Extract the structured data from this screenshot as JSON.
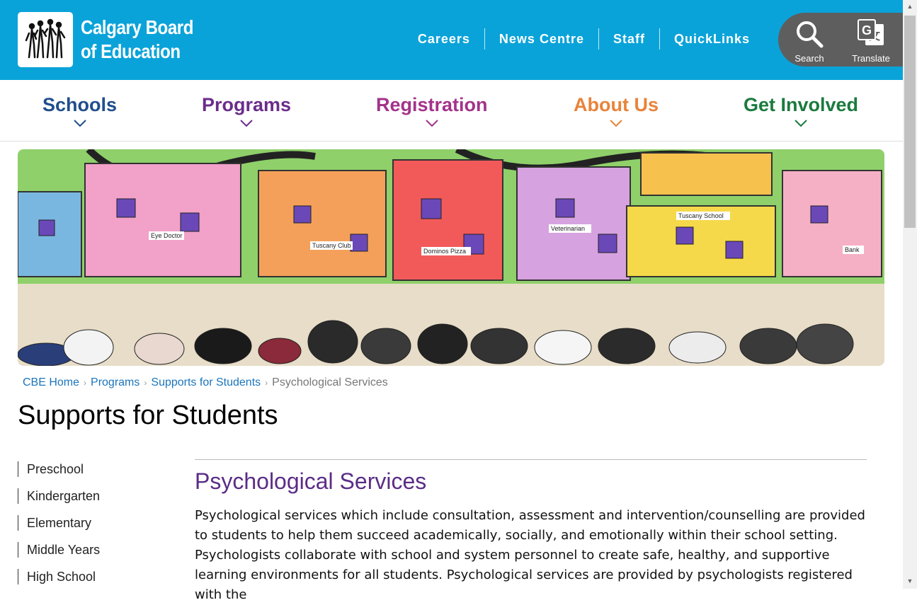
{
  "header": {
    "logo_text_line1": "Calgary Board",
    "logo_text_line2": "of Education",
    "links": [
      "Careers",
      "News Centre",
      "Staff",
      "QuickLinks"
    ],
    "search_label": "Search",
    "translate_label": "Translate"
  },
  "nav": {
    "items": [
      {
        "label": "Schools",
        "color": "#1f4e8c"
      },
      {
        "label": "Programs",
        "color": "#6b2d8b"
      },
      {
        "label": "Registration",
        "color": "#a3338a"
      },
      {
        "label": "About Us",
        "color": "#e8833a"
      },
      {
        "label": "Get Involved",
        "color": "#1b7a3e"
      }
    ]
  },
  "hero": {
    "building_labels": [
      "Eye Doctor",
      "Tuscany Club",
      "Dominos Pizza",
      "Veterinarian",
      "Tuscany School",
      "Bank"
    ]
  },
  "breadcrumb": {
    "items": [
      "CBE Home",
      "Programs",
      "Supports for Students"
    ],
    "current": "Psychological Services"
  },
  "page": {
    "title": "Supports for Students"
  },
  "sidenav": {
    "items": [
      "Preschool",
      "Kindergarten",
      "Elementary",
      "Middle Years",
      "High School"
    ]
  },
  "content": {
    "heading": "Psychological Services",
    "paragraph": "Psychological services which include consultation, assessment and intervention/counselling are provided to students to help them succeed academically, socially, and emotionally within their school setting. Psychologists collaborate with school and system personnel to create safe, healthy, and supportive learning environments for all students.  Psychological services are provided by psychologists registered with the"
  }
}
